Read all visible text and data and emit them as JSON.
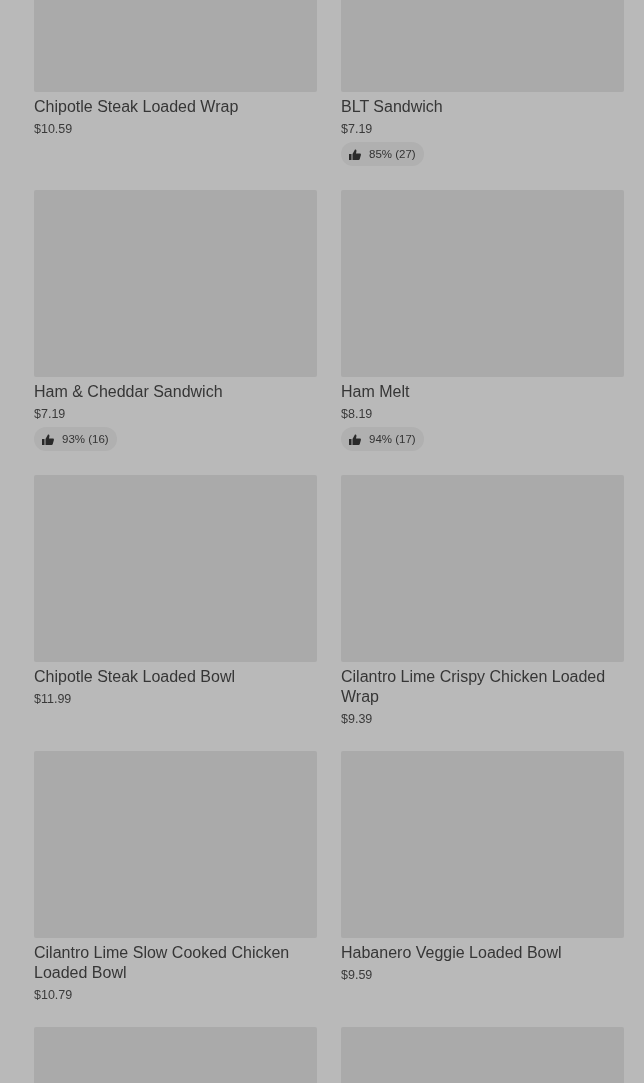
{
  "items": [
    {
      "name": "Chipotle Steak Loaded Wrap",
      "price": "$10.59",
      "picture": {
        "kind": "picture"
      }
    },
    {
      "name": "BLT Sandwich",
      "price": "$7.19",
      "rating": "85% (27)",
      "picture": {
        "kind": "picture"
      }
    },
    {
      "name": "Ham & Cheddar Sandwich",
      "price": "$7.19",
      "rating": "93% (16)",
      "picture": {
        "kind": "picture"
      }
    },
    {
      "name": "Ham Melt",
      "price": "$8.19",
      "rating": "94% (17)",
      "picture": {
        "kind": "picture"
      }
    },
    {
      "name": "Chipotle Steak Loaded Bowl",
      "price": "$11.99",
      "picture": {
        "kind": "picture"
      }
    },
    {
      "name": "Cilantro Lime Crispy Chicken Loaded Wrap",
      "price": "$9.39",
      "picture": {
        "kind": "picture"
      }
    },
    {
      "name": "Cilantro Lime Slow Cooked Chicken Loaded Bowl",
      "price": "$10.79",
      "picture": {
        "kind": "picture"
      }
    },
    {
      "name": "Habanero Veggie Loaded Bowl",
      "price": "$9.59",
      "picture": {
        "kind": "picture"
      }
    },
    {
      "picture": {
        "kind": "picture"
      }
    },
    {
      "picture": {
        "kind": "picture"
      }
    }
  ]
}
